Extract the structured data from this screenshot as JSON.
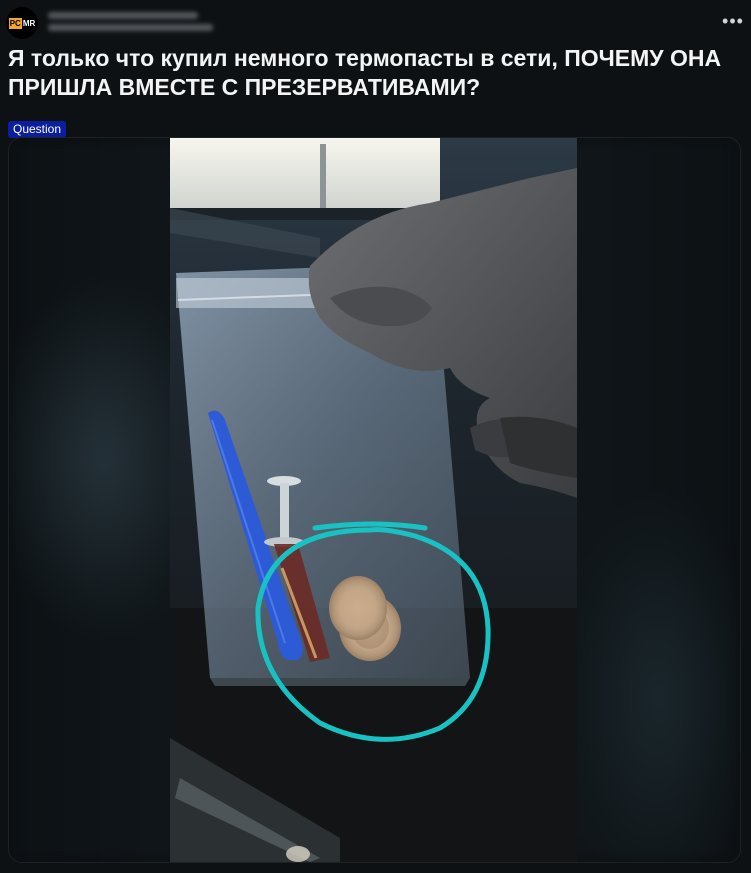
{
  "header": {
    "avatar_label_a": "PC",
    "avatar_label_b": "MR",
    "more_label": "•••"
  },
  "post": {
    "title": "Я только что купил немного термопасты в сети, ПОЧЕМУ ОНА ПРИШЛА ВМЕСТЕ С ПРЕЗЕРВАТИВАМИ?",
    "flair": "Question"
  },
  "colors": {
    "background": "#0e1113",
    "flair": "#0b1e9e",
    "annotation_circle": "#19c2c2",
    "avatar_accent": "#f5a623"
  },
  "icons": {
    "more": "more-options-icon"
  }
}
